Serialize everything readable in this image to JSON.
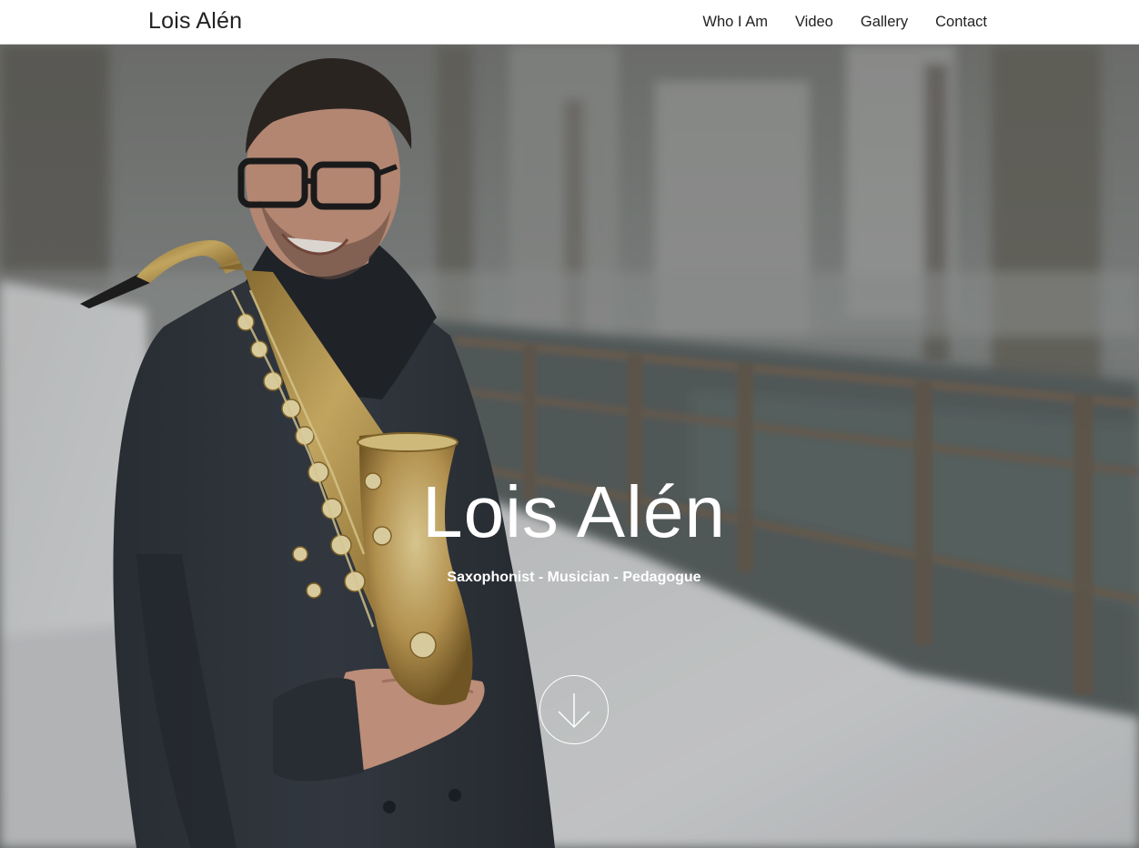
{
  "navbar": {
    "brand": "Lois Alén",
    "links": [
      {
        "label": "Who I Am"
      },
      {
        "label": "Video"
      },
      {
        "label": "Gallery"
      },
      {
        "label": "Contact"
      }
    ]
  },
  "hero": {
    "title": "Lois Alén",
    "subtitle": "Saxophonist - Musician - Pedagogue",
    "scroll_icon": "arrow-down-icon",
    "photo_subject": "saxophonist-portrait"
  },
  "colors": {
    "nav_background": "#ffffff",
    "nav_text": "#222222",
    "hero_text": "#ffffff"
  }
}
